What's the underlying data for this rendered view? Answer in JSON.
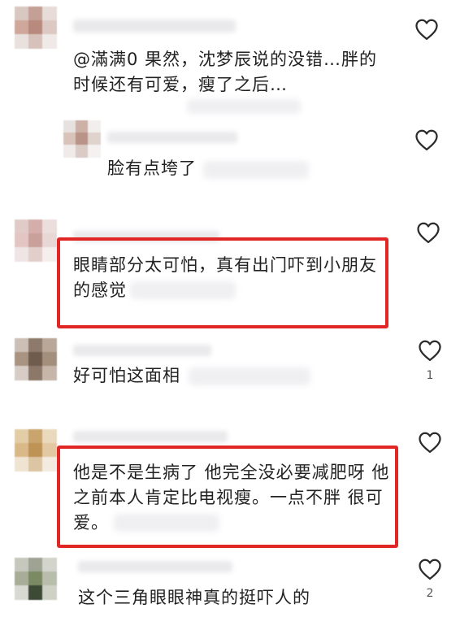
{
  "comments": [
    {
      "text_line1": "@滿满0  果然，沈梦辰说的没错…胖的",
      "text_line2": "时候还有可爱，瘦了之后…",
      "likes": ""
    },
    {
      "text_line1": "脸有点垮了",
      "likes": ""
    },
    {
      "text_line1": "眼睛部分太可怕，真有出门吓到小朋友",
      "text_line2": "的感觉",
      "likes": "",
      "highlighted": true
    },
    {
      "text_line1": "好可怕这面相",
      "likes": "1"
    },
    {
      "text_line1": "他是不是生病了 他完全没必要减肥呀 他",
      "text_line2": "之前本人肯定比电视瘦。一点不胖 很可",
      "text_line3": "爱。",
      "likes": "",
      "highlighted": true
    },
    {
      "text_line1": "这个三角眼眼神真的挺吓人的",
      "likes": "2"
    }
  ],
  "colors": {
    "highlight_border": "#e12626",
    "heart_stroke": "#2a2a2a"
  },
  "icons": [
    "heart-outline-icon"
  ]
}
